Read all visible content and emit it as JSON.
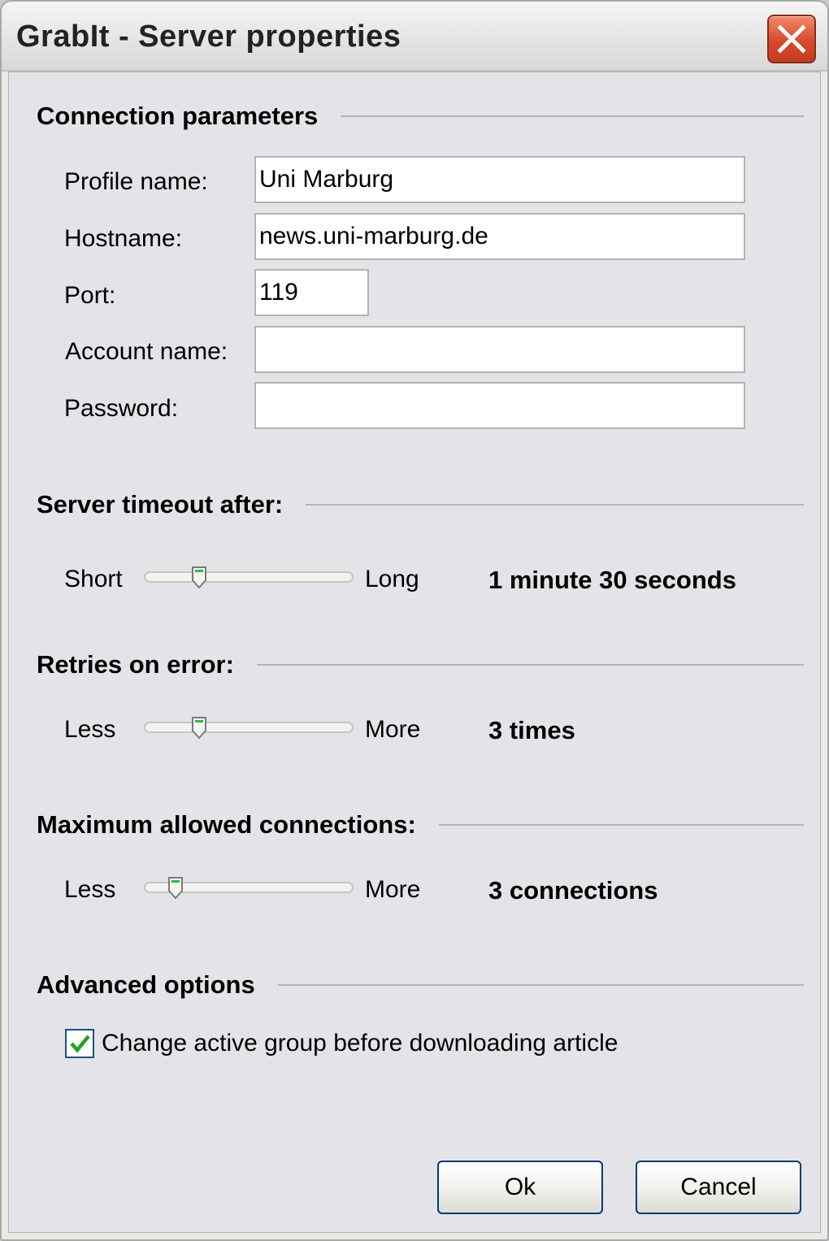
{
  "window": {
    "title": "GrabIt - Server properties"
  },
  "connection": {
    "section_title": "Connection parameters",
    "profile_label": "Profile name:",
    "profile_value": "Uni Marburg",
    "host_label": "Hostname:",
    "host_value": "news.uni-marburg.de",
    "port_label": "Port:",
    "port_value": "119",
    "account_label": "Account name:",
    "account_value": "",
    "password_label": "Password:",
    "password_value": ""
  },
  "timeout": {
    "section_title": "Server timeout after:",
    "min_label": "Short",
    "max_label": "Long",
    "value_text": "1 minute 30 seconds",
    "position": 0.24
  },
  "retries": {
    "section_title": "Retries on error:",
    "min_label": "Less",
    "max_label": "More",
    "value_text": "3 times",
    "position": 0.24
  },
  "connections": {
    "section_title": "Maximum allowed connections:",
    "min_label": "Less",
    "max_label": "More",
    "value_text": "3 connections",
    "position": 0.12
  },
  "advanced": {
    "section_title": "Advanced options",
    "change_group_label": "Change active group before downloading article",
    "change_group_checked": true
  },
  "buttons": {
    "ok": "Ok",
    "cancel": "Cancel"
  },
  "colors": {
    "close_red": "#d9482b",
    "check_green": "#21a121",
    "button_border": "#003c74"
  }
}
